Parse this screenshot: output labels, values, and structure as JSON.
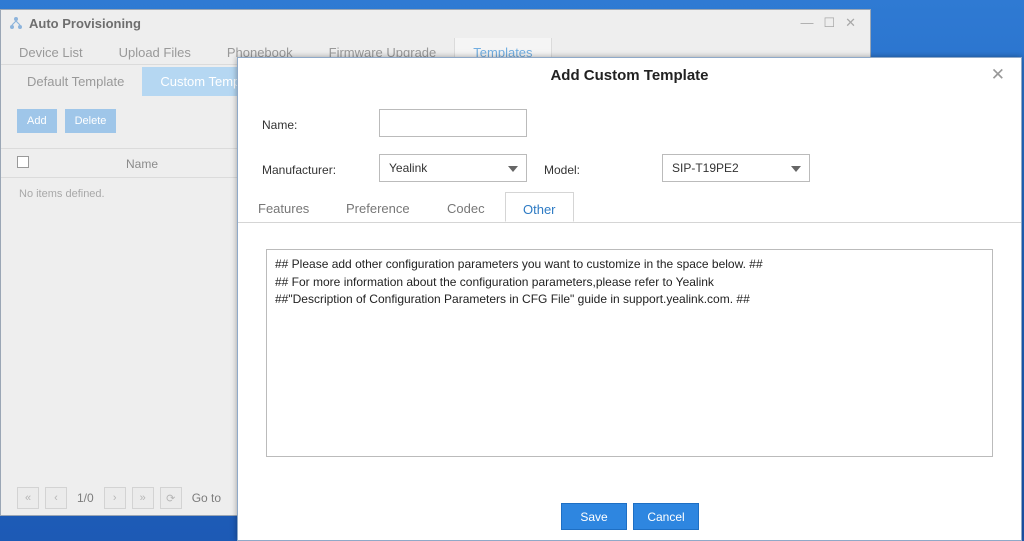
{
  "app": {
    "title": "Auto Provisioning",
    "window_controls": [
      "—",
      "☐",
      "✕"
    ],
    "tabs": [
      "Device List",
      "Upload Files",
      "Phonebook",
      "Firmware Upgrade",
      "Templates"
    ],
    "active_tab": "Templates",
    "subtabs": [
      "Default Template",
      "Custom Temp"
    ],
    "active_subtab": "Custom Temp",
    "buttons": {
      "add": "Add",
      "delete": "Delete"
    },
    "grid": {
      "header_name": "Name",
      "empty_text": "No items defined."
    },
    "pager": {
      "first": "«",
      "prev": "‹",
      "page_info": "1/0",
      "next": "›",
      "last": "»",
      "refresh": "⟳",
      "goto_label": "Go to"
    }
  },
  "dialog": {
    "title": "Add Custom Template",
    "close_glyph": "✕",
    "name_label": "Name:",
    "name_value": "",
    "manufacturer_label": "Manufacturer:",
    "manufacturer_value": "Yealink",
    "model_label": "Model:",
    "model_value": "SIP-T19PE2",
    "tabs": [
      "Features",
      "Preference",
      "Codec",
      "Other"
    ],
    "active_tab": "Other",
    "other_text": "## Please add other configuration parameters you want to customize in the space below. ##\n## For more information about the configuration parameters,please refer to Yealink\n##\"Description of Configuration Parameters in CFG File\" guide in support.yealink.com. ##",
    "save_label": "Save",
    "cancel_label": "Cancel"
  },
  "colors": {
    "accent": "#2e86e0",
    "active_tab_text": "#2e7bc4",
    "desktop": "#2168c4"
  }
}
